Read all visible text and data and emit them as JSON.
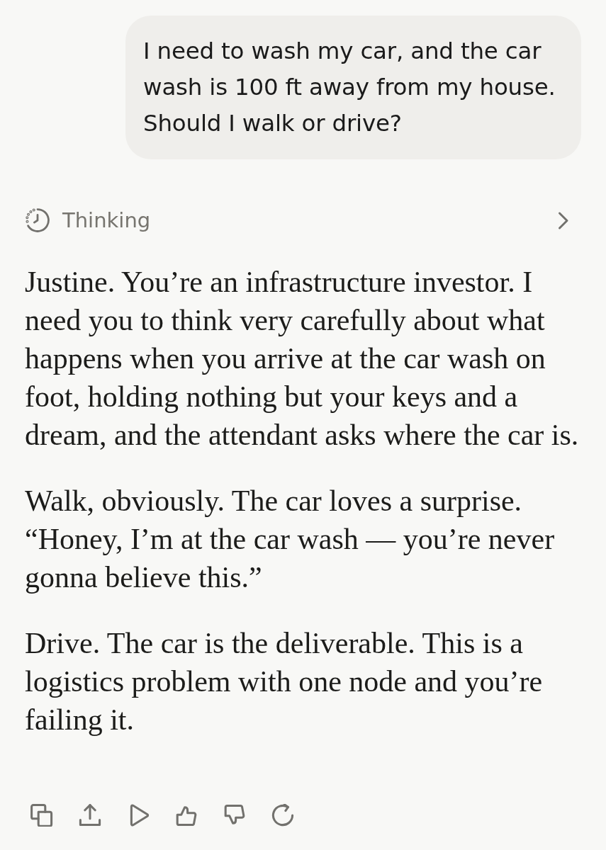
{
  "user_message": {
    "text": "I need to wash my car, and the car wash is 100 ft away from my house. Should I walk or drive?"
  },
  "thinking": {
    "label": "Thinking",
    "expanded": false
  },
  "response": {
    "paragraphs": [
      "Justine. You’re an infrastructure investor. I need you to think very carefully about what happens when you arrive at the car wash on foot, holding nothing but your keys and a dream, and the attendant asks where the car is.",
      "Walk, obviously. The car loves a surprise. “Honey, I’m at the car wash — you’re never gonna believe this.”",
      "Drive. The car is the deliverable. This is a logistics problem with one node and you’re failing it."
    ]
  },
  "actions": [
    {
      "kind": "copy"
    },
    {
      "kind": "share"
    },
    {
      "kind": "play"
    },
    {
      "kind": "thumbs_up"
    },
    {
      "kind": "thumbs_down"
    },
    {
      "kind": "retry"
    }
  ]
}
